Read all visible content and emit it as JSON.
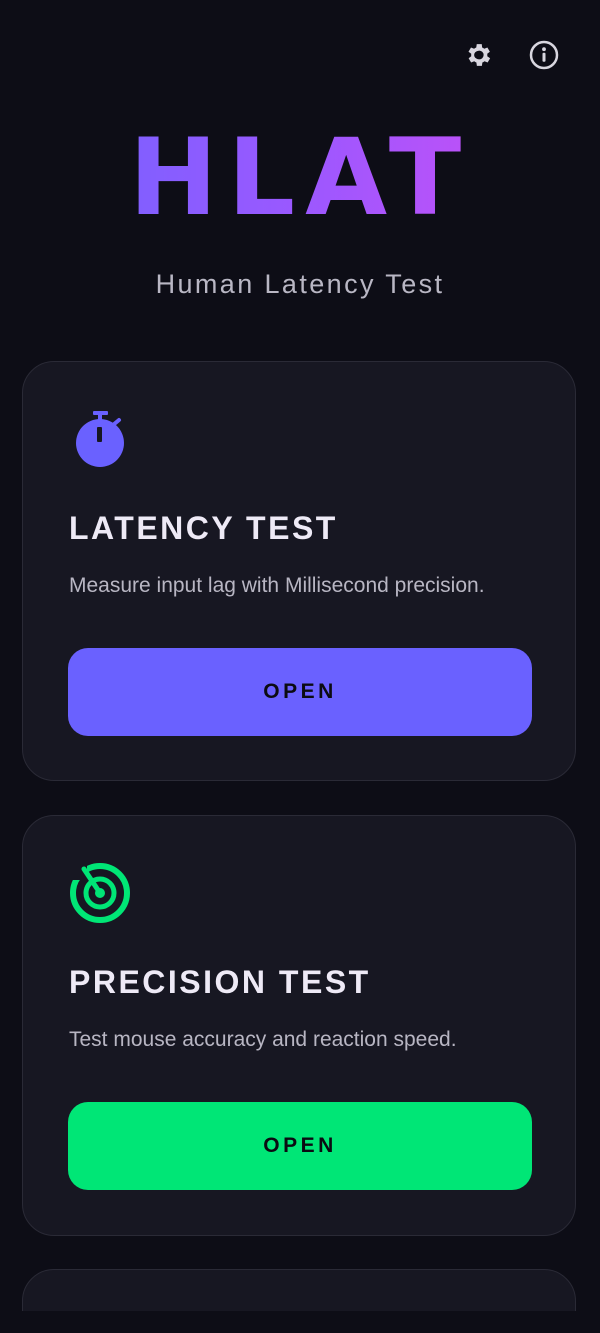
{
  "header": {
    "settings_icon": "gear-icon",
    "info_icon": "info-icon"
  },
  "hero": {
    "logo": "HLAT",
    "subtitle": "Human Latency Test",
    "logo_gradient": [
      "#6e64ff",
      "#d24df3"
    ]
  },
  "cards": [
    {
      "icon": "stopwatch-icon",
      "title": "LATENCY TEST",
      "description": "Measure input lag with Millisecond precision.",
      "button_label": "OPEN",
      "accent": "#6a61ff"
    },
    {
      "icon": "target-icon",
      "title": "PRECISION TEST",
      "description": "Test mouse accuracy and reaction speed.",
      "button_label": "OPEN",
      "accent": "#00e676"
    }
  ],
  "colors": {
    "background": "#0d0d16",
    "card": "#171722",
    "card_border": "#2a2a36",
    "text": "#e9e7f1",
    "muted_text": "#b8b6c3"
  }
}
